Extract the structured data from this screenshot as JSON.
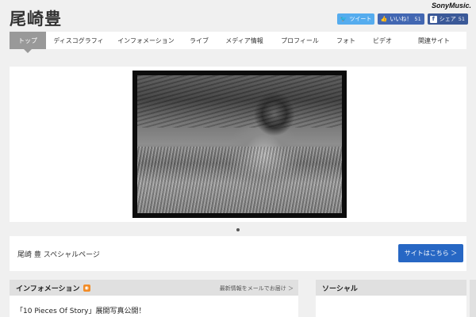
{
  "header": {
    "title": "尾崎豊",
    "label_logo": "SonyMusic."
  },
  "share": {
    "tweet": {
      "icon": "twitter-bird-icon",
      "label": "ツイート"
    },
    "like": {
      "icon": "thumbs-up-icon",
      "label": "いいね！",
      "count": "51"
    },
    "share": {
      "icon": "facebook-icon",
      "label": "シェア",
      "count": "51"
    }
  },
  "nav": {
    "items": [
      {
        "label": "トップ",
        "active": true
      },
      {
        "label": "ディスコグラフィ"
      },
      {
        "label": "インフォメーション"
      },
      {
        "label": "ライブ"
      },
      {
        "label": "メディア情報"
      },
      {
        "label": "プロフィール"
      },
      {
        "label": "フォト"
      },
      {
        "label": "ビデオ"
      },
      {
        "label": "関連サイト"
      }
    ]
  },
  "special": {
    "text": "尾崎 豊 スペシャルページ",
    "button": "サイトはこちら ＞"
  },
  "info": {
    "title": "インフォメーション",
    "rss_icon": "rss-icon",
    "mail_link": "最新情報をメールでお届け ＞",
    "items": [
      "「10 Pieces Of Story」展開写真公開！"
    ]
  },
  "social_panel": {
    "title": "ソーシャル"
  },
  "colors": {
    "accent_blue": "#2767c4",
    "twitter": "#55acee",
    "facebook": "#3b5998",
    "nav_active": "#999999"
  }
}
